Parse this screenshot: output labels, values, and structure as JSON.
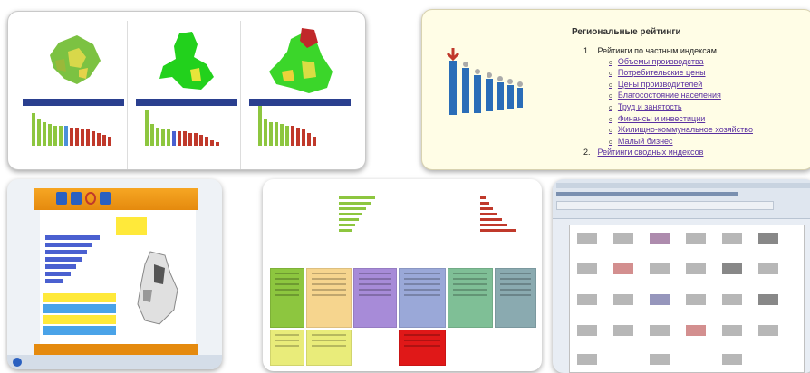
{
  "ratings": {
    "title": "Региональные рейтинги",
    "item1_num": "1.",
    "item1_label": "Рейтинги по частным индексам",
    "subitems": [
      "Объемы производства",
      "Потребительские цены",
      "Цены производителей",
      "Благосостояние населения",
      "Труд и занятость",
      "Финансы и инвестиции",
      "Жилищно-коммунальное хозяйство",
      "Малый бизнес"
    ],
    "item2_num": "2.",
    "item2_label": "Рейтинги сводных индексов"
  },
  "colors": {
    "green": "#8dc63f",
    "red": "#c0392b",
    "blue": "#4a60d0",
    "link": "#5a30a0",
    "orange": "#e58a0e"
  },
  "icons": [
    "map-icon",
    "bar-chart-icon",
    "document-icon"
  ]
}
